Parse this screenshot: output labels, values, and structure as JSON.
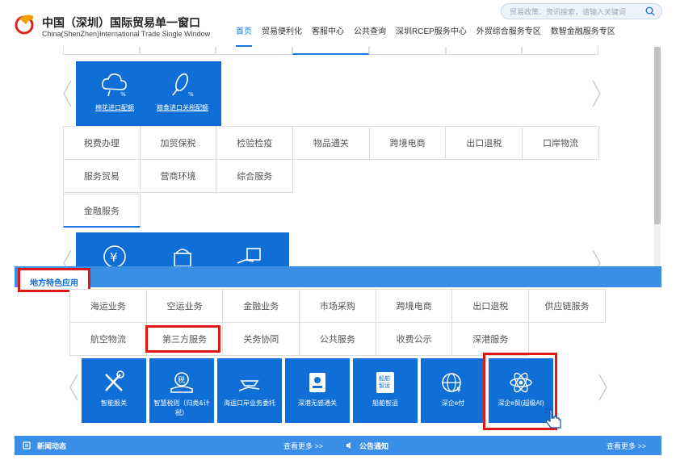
{
  "header": {
    "title_cn": "中国（深圳）国际贸易单一窗口",
    "title_en": "China(ShenZhen)International Trade Single Window",
    "search_placeholder": "贸易政策、资讯搜索，请输入关键词",
    "nav": [
      "首页",
      "贸易便利化",
      "客服中心",
      "公共查询",
      "深圳RCEP服务中心",
      "外贸综合服务专区",
      "数智金融服务专区"
    ],
    "nav_active_index": 0
  },
  "upper": {
    "tiles_row1": [
      {
        "label": "棉花进口配额",
        "icon": "cotton-cloud-icon"
      },
      {
        "label": "粮食进口关税配额",
        "icon": "grain-percent-icon"
      }
    ],
    "categories": [
      "税费办理",
      "加贸保税",
      "检验检疫",
      "物品通关",
      "跨境电商",
      "出口退税",
      "口岸物流",
      "服务贸易",
      "营商环境",
      "综合服务",
      "金融服务"
    ],
    "active_category": "金融服务",
    "tiles_row2_icons": [
      "yen-globe-icon",
      "insurance-icon",
      "finance-safe-icon"
    ]
  },
  "local_apps": {
    "section_title": "地方特色应用",
    "tabs": [
      "海运业务",
      "空运业务",
      "金融业务",
      "市场采购",
      "跨境电商",
      "出口退税",
      "供应链服务",
      "航空物流",
      "第三方服务",
      "关务协同",
      "公共服务",
      "收费公示",
      "深港服务"
    ],
    "active_tab": "第三方服务",
    "apps": [
      {
        "label": "智能报关",
        "icon": "tools-icon"
      },
      {
        "label": "智慧税则（归类&计税）",
        "icon": "tax-bag-icon"
      },
      {
        "label": "海运口岸业务委托",
        "icon": "ship-hand-icon"
      },
      {
        "label": "深港无感通关",
        "icon": "id-card-icon"
      },
      {
        "label": "船舶智运",
        "icon": "ship-book-icon"
      },
      {
        "label": "深企e付",
        "icon": "globe-pay-icon"
      },
      {
        "label": "深企e贸(超级AI)",
        "icon": "atom-ai-icon"
      }
    ]
  },
  "footer": {
    "news_label": "新闻动态",
    "news_more": "查看更多 >>",
    "notice_label": "公告通知",
    "notice_more": "查看更多 >>"
  },
  "colors": {
    "brand_blue": "#0f6fd6",
    "bar_blue": "#3a8ee6",
    "highlight_red": "#e21818",
    "accent": "#1677e5"
  }
}
